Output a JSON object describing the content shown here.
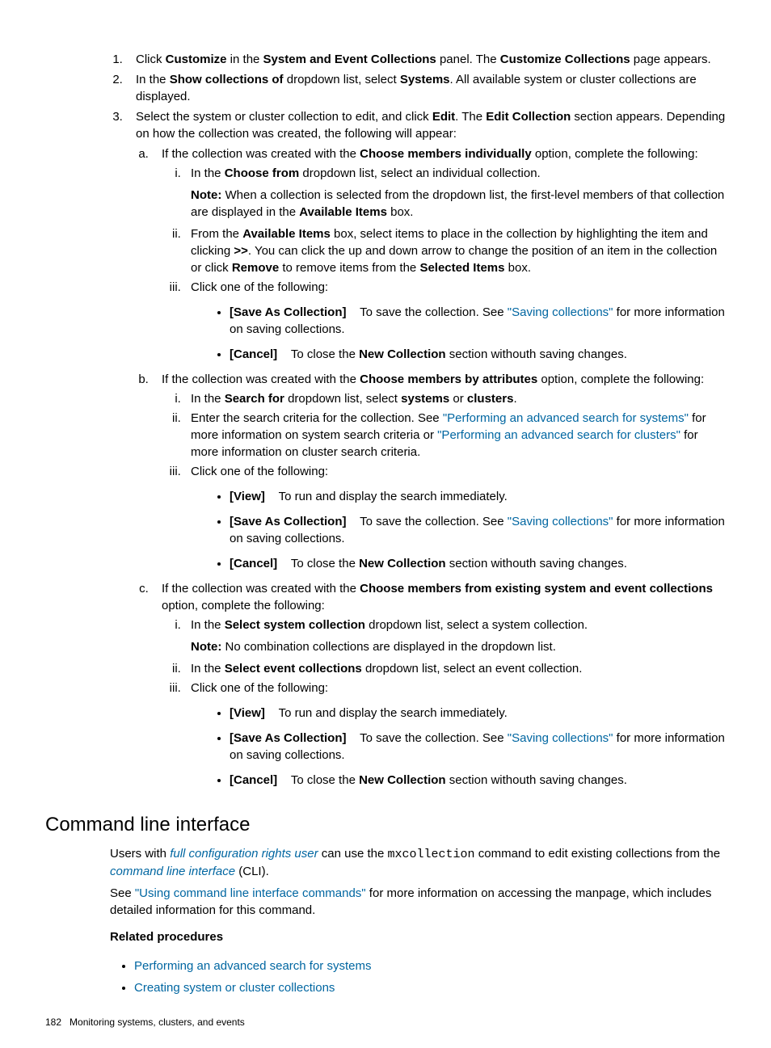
{
  "step1": {
    "pre": "Click ",
    "b1": "Customize",
    "mid1": " in the ",
    "b2": "System and Event Collections",
    "mid2": " panel. The ",
    "b3": "Customize Collections",
    "post": " page appears."
  },
  "step2": {
    "pre": "In the ",
    "b1": "Show collections of",
    "mid1": " dropdown list, select ",
    "b2": "Systems",
    "post": ". All available system or cluster collections are displayed."
  },
  "step3": {
    "pre": "Select the system or cluster collection to edit, and click ",
    "b1": "Edit",
    "mid1": ". The ",
    "b2": "Edit Collection",
    "post": " section appears. Depending on how the collection was created, the following will appear:"
  },
  "a": {
    "intro_pre": "If the collection was created with the ",
    "intro_b": "Choose members individually",
    "intro_post": " option, complete the following:",
    "i_pre": "In the ",
    "i_b": "Choose from",
    "i_post": " dropdown list, select an individual collection.",
    "note_b": "Note:",
    "note_mid": " When a collection is selected from the dropdown list, the first-level members of that collection are displayed in the ",
    "note_b2": "Available Items",
    "note_post": " box.",
    "ii_pre": "From the ",
    "ii_b1": "Available Items",
    "ii_mid1": " box, select items to place in the collection by highlighting the item and clicking ",
    "ii_b2": ">>",
    "ii_mid2": ". You can click the up and down arrow to change the position of an item in the collection or click ",
    "ii_b3": "Remove",
    "ii_mid3": " to remove items from the ",
    "ii_b4": "Selected Items",
    "ii_post": " box.",
    "iii": "Click one of the following:"
  },
  "save_bullet": {
    "b": "[Save As Collection]",
    "pre": "To save the collection. See ",
    "link": "\"Saving collections\"",
    "post": " for more information on saving collections."
  },
  "cancel_bullet": {
    "b": "[Cancel]",
    "pre": "To close the ",
    "b2": "New Collection",
    "post": " section withouth saving changes."
  },
  "view_bullet": {
    "b": "[View]",
    "text": "To run and display the search immediately."
  },
  "b_sec": {
    "intro_pre": "If the collection was created with the ",
    "intro_b": "Choose members by attributes",
    "intro_post": " option, complete the following:",
    "i_pre": "In the ",
    "i_b1": "Search for",
    "i_mid": " dropdown list, select ",
    "i_b2": "systems",
    "i_or": " or ",
    "i_b3": "clusters",
    "i_post": ".",
    "ii_pre": "Enter the search criteria for the collection. See ",
    "ii_link1": "\"Performing an advanced search for systems\"",
    "ii_mid": " for more information on system search criteria or ",
    "ii_link2": "\"Performing an advanced search for clusters\"",
    "ii_post": " for more information on cluster search criteria.",
    "iii": "Click one of the following:"
  },
  "c_sec": {
    "intro_pre": "If the collection was created with the ",
    "intro_b": "Choose members from existing system and event collections",
    "intro_post": " option, complete the following:",
    "i_pre": "In the ",
    "i_b": "Select system collection",
    "i_post": " dropdown list, select a system collection.",
    "note_b": "Note:",
    "note_post": " No combination collections are displayed in the dropdown list.",
    "ii_pre": "In the ",
    "ii_b": "Select event collections",
    "ii_post": " dropdown list, select an event collection.",
    "iii": "Click one of the following:"
  },
  "cli": {
    "heading": "Command line interface",
    "p1_pre": "Users with ",
    "p1_g1": "full configuration rights user",
    "p1_mid1": " can use the ",
    "p1_code": "mxcollection",
    "p1_mid2": " command to edit existing collections from the ",
    "p1_g2": "command line interface",
    "p1_post": " (CLI).",
    "p2_pre": "See ",
    "p2_link": "\"Using command line interface commands\"",
    "p2_post": " for more information on accessing the manpage, which includes detailed information for this command."
  },
  "related": {
    "head": "Related procedures",
    "l1": "Performing an advanced search for systems",
    "l2": "Creating system or cluster collections"
  },
  "footer": {
    "page": "182",
    "chapter": "Monitoring systems, clusters, and events"
  }
}
